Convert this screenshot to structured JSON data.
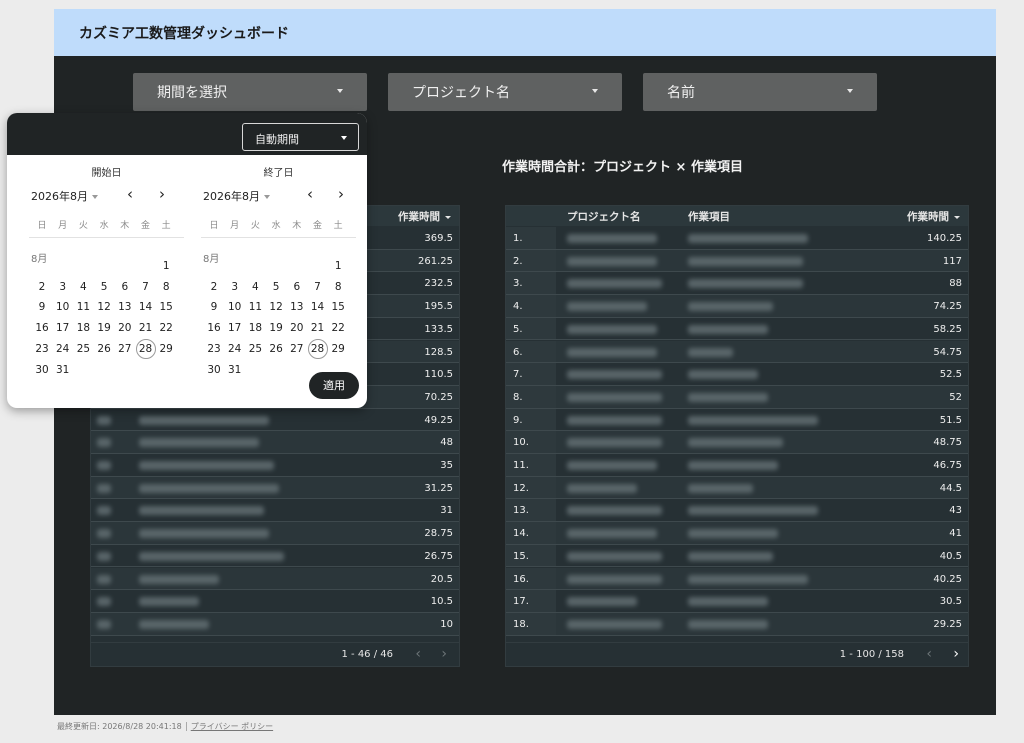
{
  "header": {
    "title": "カズミア工数管理ダッシュボード"
  },
  "filters": [
    {
      "label": "期間を選択"
    },
    {
      "label": "プロジェクト名"
    },
    {
      "label": "名前"
    }
  ],
  "chart_title": "作業時間合計：プロジェクト × 作業項目",
  "left_table": {
    "col_hours": "作業時間",
    "values": [
      "369.5",
      "261.25",
      "232.5",
      "195.5",
      "133.5",
      "128.5",
      "110.5",
      "70.25",
      "49.25",
      "48",
      "35",
      "31.25",
      "31",
      "28.75",
      "26.75",
      "20.5",
      "10.5",
      "10"
    ],
    "pagination": "1 - 46 / 46"
  },
  "right_table": {
    "col_project": "プロジェクト名",
    "col_item": "作業項目",
    "col_hours": "作業時間",
    "rows": [
      {
        "idx": "1.",
        "hours": "140.25"
      },
      {
        "idx": "2.",
        "hours": "117"
      },
      {
        "idx": "3.",
        "hours": "88"
      },
      {
        "idx": "4.",
        "hours": "74.25"
      },
      {
        "idx": "5.",
        "hours": "58.25"
      },
      {
        "idx": "6.",
        "hours": "54.75"
      },
      {
        "idx": "7.",
        "hours": "52.5"
      },
      {
        "idx": "8.",
        "hours": "52"
      },
      {
        "idx": "9.",
        "hours": "51.5"
      },
      {
        "idx": "10.",
        "hours": "48.75"
      },
      {
        "idx": "11.",
        "hours": "46.75"
      },
      {
        "idx": "12.",
        "hours": "44.5"
      },
      {
        "idx": "13.",
        "hours": "43"
      },
      {
        "idx": "14.",
        "hours": "41"
      },
      {
        "idx": "15.",
        "hours": "40.5"
      },
      {
        "idx": "16.",
        "hours": "40.25"
      },
      {
        "idx": "17.",
        "hours": "30.5"
      },
      {
        "idx": "18.",
        "hours": "29.25"
      }
    ],
    "pagination": "1 - 100 / 158"
  },
  "date_picker": {
    "auto_period": "自動期間",
    "start": {
      "title": "開始日",
      "month": "2026年8月"
    },
    "end": {
      "title": "終了日",
      "month": "2026年8月"
    },
    "weekdays": [
      "日",
      "月",
      "火",
      "水",
      "木",
      "金",
      "土"
    ],
    "month_label": "8月",
    "selected_day": 28,
    "apply": "適用"
  },
  "footer": {
    "updated": "最終更新日: 2026/8/28 20:41:18",
    "privacy": "プライバシー ポリシー"
  }
}
